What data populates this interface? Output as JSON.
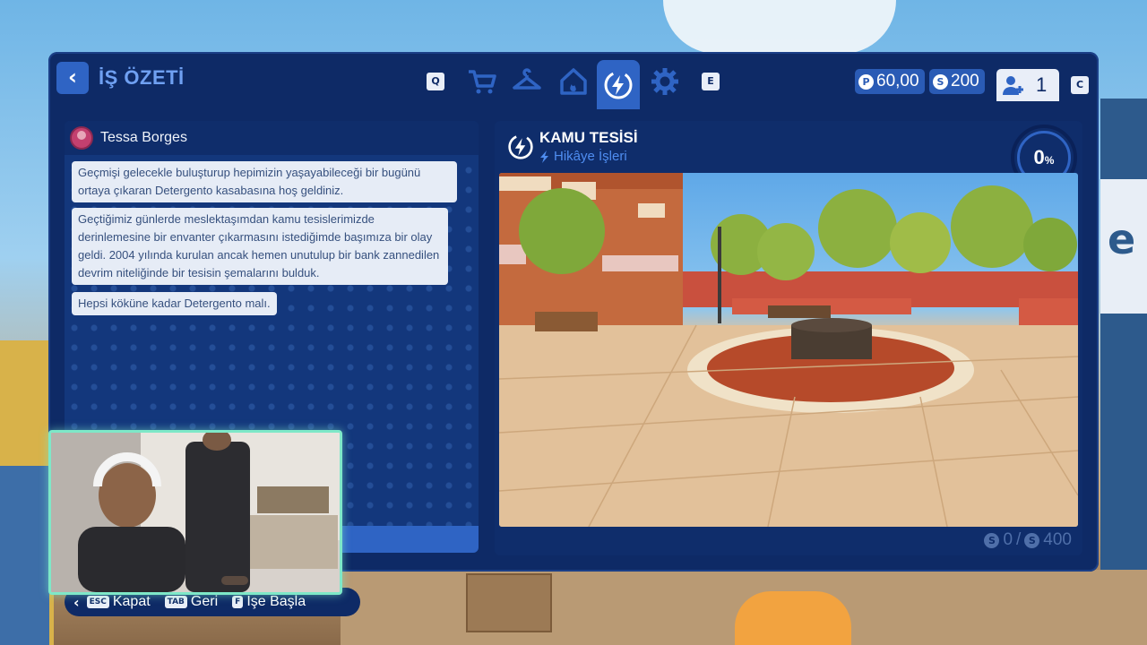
{
  "header": {
    "title": "İŞ ÖZETİ",
    "tab_prev_key": "Q",
    "tab_next_key": "E",
    "tabs": [
      {
        "icon": "cart-icon"
      },
      {
        "icon": "hanger-icon"
      },
      {
        "icon": "house-fire-icon"
      },
      {
        "icon": "lightning-icon",
        "active": true
      },
      {
        "icon": "gear-icon"
      }
    ],
    "currency_p": "60,00",
    "currency_s": "200",
    "players_count": "1",
    "players_key": "C",
    "coin_p_glyph": "P",
    "coin_s_glyph": "S"
  },
  "chat": {
    "speaker": "Tessa Borges",
    "messages": [
      "Geçmişi gelecekle buluşturup hepimizin yaşayabileceği bir bugünü ortaya çıkaran Detergento kasabasına hoş geldiniz.",
      "Geçtiğimiz günlerde meslektaşımdan kamu tesislerimizde derinlemesine bir envanter çıkarmasını istediğimde başımıza bir olay geldi. 2004 yılında kurulan ancak hemen unutulup bir bank zannedilen devrim niteliğinde bir tesisin şemalarını bulduk.",
      "Hepsi köküne kadar Detergento malı."
    ]
  },
  "job": {
    "title": "KAMU TESİSİ",
    "subtitle": "Hikâye İşleri",
    "progress": "0",
    "progress_unit": "%",
    "reward_current": "0",
    "reward_separator": "/",
    "reward_total": "400"
  },
  "controls": [
    {
      "key": "ESC",
      "label": "Kapat"
    },
    {
      "key": "TAB",
      "label": "Geri"
    },
    {
      "key": "F",
      "label": "İşe Başla"
    }
  ],
  "colors": {
    "panel": "#0e2a66",
    "accent": "#2f64c4",
    "webcam_border": "#7ee8c8"
  }
}
